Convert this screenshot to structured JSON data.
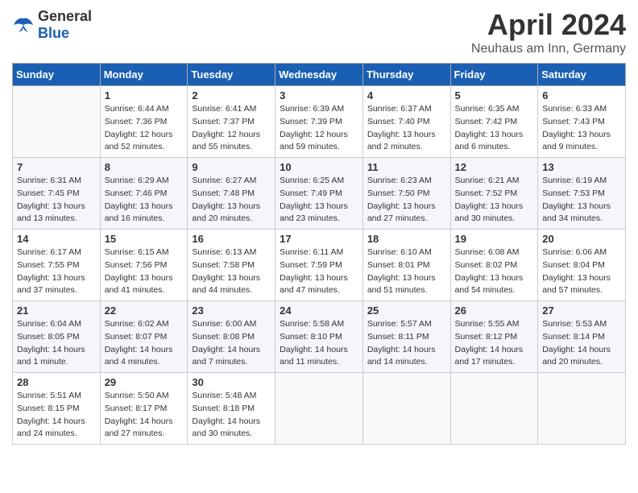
{
  "header": {
    "logo_general": "General",
    "logo_blue": "Blue",
    "month_title": "April 2024",
    "location": "Neuhaus am Inn, Germany"
  },
  "days_of_week": [
    "Sunday",
    "Monday",
    "Tuesday",
    "Wednesday",
    "Thursday",
    "Friday",
    "Saturday"
  ],
  "weeks": [
    [
      {
        "day": "",
        "sunrise": "",
        "sunset": "",
        "daylight": ""
      },
      {
        "day": "1",
        "sunrise": "6:44 AM",
        "sunset": "7:36 PM",
        "daylight": "12 hours and 52 minutes."
      },
      {
        "day": "2",
        "sunrise": "6:41 AM",
        "sunset": "7:37 PM",
        "daylight": "12 hours and 55 minutes."
      },
      {
        "day": "3",
        "sunrise": "6:39 AM",
        "sunset": "7:39 PM",
        "daylight": "12 hours and 59 minutes."
      },
      {
        "day": "4",
        "sunrise": "6:37 AM",
        "sunset": "7:40 PM",
        "daylight": "13 hours and 2 minutes."
      },
      {
        "day": "5",
        "sunrise": "6:35 AM",
        "sunset": "7:42 PM",
        "daylight": "13 hours and 6 minutes."
      },
      {
        "day": "6",
        "sunrise": "6:33 AM",
        "sunset": "7:43 PM",
        "daylight": "13 hours and 9 minutes."
      }
    ],
    [
      {
        "day": "7",
        "sunrise": "6:31 AM",
        "sunset": "7:45 PM",
        "daylight": "13 hours and 13 minutes."
      },
      {
        "day": "8",
        "sunrise": "6:29 AM",
        "sunset": "7:46 PM",
        "daylight": "13 hours and 16 minutes."
      },
      {
        "day": "9",
        "sunrise": "6:27 AM",
        "sunset": "7:48 PM",
        "daylight": "13 hours and 20 minutes."
      },
      {
        "day": "10",
        "sunrise": "6:25 AM",
        "sunset": "7:49 PM",
        "daylight": "13 hours and 23 minutes."
      },
      {
        "day": "11",
        "sunrise": "6:23 AM",
        "sunset": "7:50 PM",
        "daylight": "13 hours and 27 minutes."
      },
      {
        "day": "12",
        "sunrise": "6:21 AM",
        "sunset": "7:52 PM",
        "daylight": "13 hours and 30 minutes."
      },
      {
        "day": "13",
        "sunrise": "6:19 AM",
        "sunset": "7:53 PM",
        "daylight": "13 hours and 34 minutes."
      }
    ],
    [
      {
        "day": "14",
        "sunrise": "6:17 AM",
        "sunset": "7:55 PM",
        "daylight": "13 hours and 37 minutes."
      },
      {
        "day": "15",
        "sunrise": "6:15 AM",
        "sunset": "7:56 PM",
        "daylight": "13 hours and 41 minutes."
      },
      {
        "day": "16",
        "sunrise": "6:13 AM",
        "sunset": "7:58 PM",
        "daylight": "13 hours and 44 minutes."
      },
      {
        "day": "17",
        "sunrise": "6:11 AM",
        "sunset": "7:59 PM",
        "daylight": "13 hours and 47 minutes."
      },
      {
        "day": "18",
        "sunrise": "6:10 AM",
        "sunset": "8:01 PM",
        "daylight": "13 hours and 51 minutes."
      },
      {
        "day": "19",
        "sunrise": "6:08 AM",
        "sunset": "8:02 PM",
        "daylight": "13 hours and 54 minutes."
      },
      {
        "day": "20",
        "sunrise": "6:06 AM",
        "sunset": "8:04 PM",
        "daylight": "13 hours and 57 minutes."
      }
    ],
    [
      {
        "day": "21",
        "sunrise": "6:04 AM",
        "sunset": "8:05 PM",
        "daylight": "14 hours and 1 minute."
      },
      {
        "day": "22",
        "sunrise": "6:02 AM",
        "sunset": "8:07 PM",
        "daylight": "14 hours and 4 minutes."
      },
      {
        "day": "23",
        "sunrise": "6:00 AM",
        "sunset": "8:08 PM",
        "daylight": "14 hours and 7 minutes."
      },
      {
        "day": "24",
        "sunrise": "5:58 AM",
        "sunset": "8:10 PM",
        "daylight": "14 hours and 11 minutes."
      },
      {
        "day": "25",
        "sunrise": "5:57 AM",
        "sunset": "8:11 PM",
        "daylight": "14 hours and 14 minutes."
      },
      {
        "day": "26",
        "sunrise": "5:55 AM",
        "sunset": "8:12 PM",
        "daylight": "14 hours and 17 minutes."
      },
      {
        "day": "27",
        "sunrise": "5:53 AM",
        "sunset": "8:14 PM",
        "daylight": "14 hours and 20 minutes."
      }
    ],
    [
      {
        "day": "28",
        "sunrise": "5:51 AM",
        "sunset": "8:15 PM",
        "daylight": "14 hours and 24 minutes."
      },
      {
        "day": "29",
        "sunrise": "5:50 AM",
        "sunset": "8:17 PM",
        "daylight": "14 hours and 27 minutes."
      },
      {
        "day": "30",
        "sunrise": "5:48 AM",
        "sunset": "8:18 PM",
        "daylight": "14 hours and 30 minutes."
      },
      {
        "day": "",
        "sunrise": "",
        "sunset": "",
        "daylight": ""
      },
      {
        "day": "",
        "sunrise": "",
        "sunset": "",
        "daylight": ""
      },
      {
        "day": "",
        "sunrise": "",
        "sunset": "",
        "daylight": ""
      },
      {
        "day": "",
        "sunrise": "",
        "sunset": "",
        "daylight": ""
      }
    ]
  ]
}
